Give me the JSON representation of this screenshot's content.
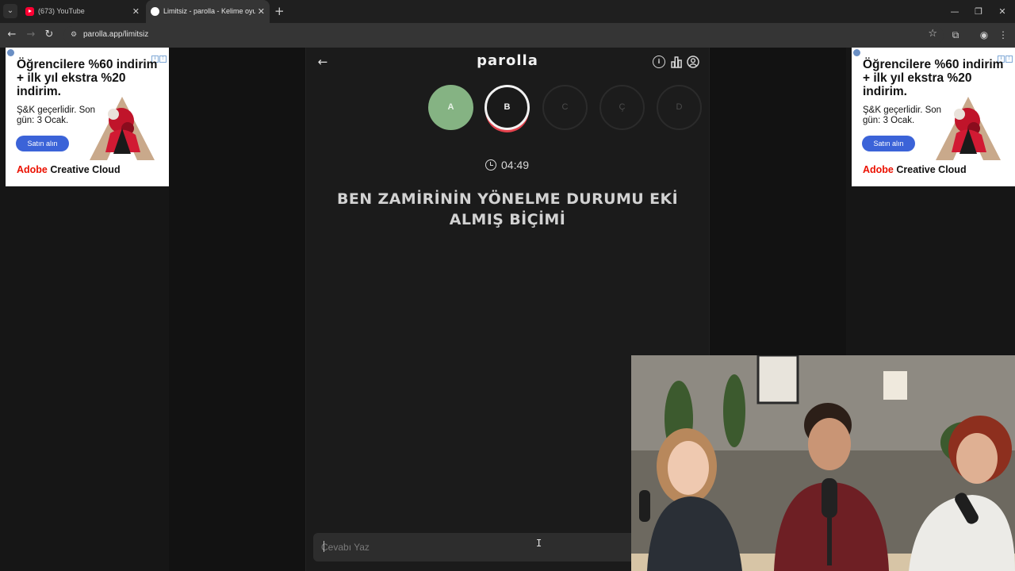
{
  "browser": {
    "tabs": [
      {
        "title": "(673) YouTube",
        "active": false
      },
      {
        "title": "Limitsiz - parolla - Kelime oyunu",
        "active": true
      }
    ],
    "url": "parolla.app/limitsiz"
  },
  "ads": {
    "headline": "Öğrencilere %60 indirim + ilk yıl ekstra %20 indirim.",
    "subtext": "Ş&K geçerlidir. Son gün: 3 Ocak.",
    "button": "Satın alın",
    "brand_red": "Adobe",
    "brand_rest": " Creative Cloud"
  },
  "game": {
    "logo": "parolla",
    "letters": [
      {
        "letter": "A",
        "state": "done"
      },
      {
        "letter": "B",
        "state": "current"
      },
      {
        "letter": "C",
        "state": "todo"
      },
      {
        "letter": "Ç",
        "state": "todo"
      },
      {
        "letter": "D",
        "state": "todo"
      }
    ],
    "timer": "04:49",
    "question": "BEN ZAMİRİNİN YÖNELME DURUMU EKİ ALMIŞ BİÇİMİ",
    "answer_placeholder": "Cevabı Yaz",
    "answer_value": ""
  },
  "colors": {
    "done": "#85b383",
    "current_ring": "#f2f2f2",
    "current_accent": "#e4424d",
    "ad_button": "#3b63d8",
    "adobe_red": "#eb1000"
  }
}
